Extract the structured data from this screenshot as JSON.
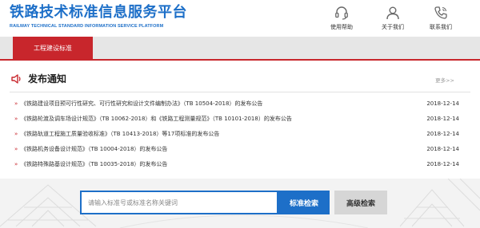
{
  "header": {
    "site_title": "铁路技术标准信息服务平台",
    "site_subtitle": "RAILWAY TECHNICAL STANDARD INFORMATION SERVICE PLATFORM",
    "links": [
      {
        "label": "使用帮助",
        "icon": "headset-icon"
      },
      {
        "label": "关于我们",
        "icon": "user-icon"
      },
      {
        "label": "联系我们",
        "icon": "phone-icon"
      }
    ]
  },
  "nav": {
    "active_tab": "工程建设标准"
  },
  "notices": {
    "title": "发布通知",
    "more": "更多>>",
    "items": [
      {
        "title": "《铁路建设项目预可行性研究、可行性研究和设计文件编制办法》（TB 10504-2018）的发布公告",
        "date": "2018-12-14"
      },
      {
        "title": "《铁路轮渡及调车场设计规范》（TB 10062-2018）和《铁路工程测量规范》（TB 10101-2018）的发布公告",
        "date": "2018-12-14"
      },
      {
        "title": "《铁路轨道工程施工质量验收标准》（TB 10413-2018）等17项标准的发布公告",
        "date": "2018-12-14"
      },
      {
        "title": "《铁路机务设备设计规范》（TB 10004-2018）的发布公告",
        "date": "2018-12-14"
      },
      {
        "title": "《铁路特殊路基设计规范》（TB 10035-2018）的发布公告",
        "date": "2018-12-14"
      }
    ]
  },
  "search": {
    "placeholder": "请输入标准号或标准名称关键词",
    "search_label": "标准检索",
    "advanced_label": "高级检索"
  },
  "colors": {
    "brand_blue": "#1d6fc8",
    "accent_red": "#c8262c"
  }
}
